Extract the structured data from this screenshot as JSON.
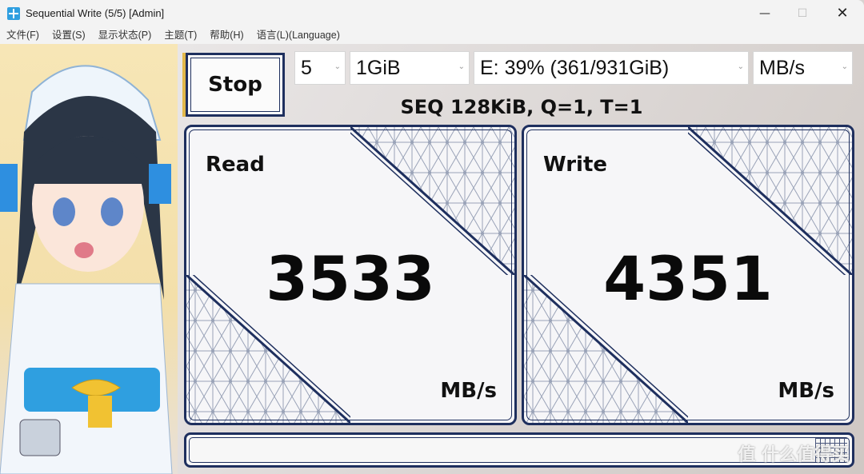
{
  "window": {
    "title": "Sequential Write (5/5) [Admin]",
    "minimize": "—",
    "maximize": "☐",
    "close": "✕"
  },
  "menu": [
    "文件(F)",
    "设置(S)",
    "显示状态(P)",
    "主题(T)",
    "帮助(H)",
    "语言(L)(Language)"
  ],
  "toolbar": {
    "stop_label": "Stop",
    "count": "5",
    "size": "1GiB",
    "drive": "E: 39% (361/931GiB)",
    "unit": "MB/s",
    "chevron": "⌄"
  },
  "test": {
    "label": "SEQ 128KiB, Q=1, T=1"
  },
  "read": {
    "label": "Read",
    "value": "3533",
    "unit": "MB/s"
  },
  "write": {
    "label": "Write",
    "value": "4351",
    "unit": "MB/s"
  },
  "status": {
    "text": ""
  },
  "watermark": "值 什么值得买",
  "colors": {
    "frame": "#1e2f5e",
    "pattern": "#9aa3b8",
    "accent": "#e2b84a"
  }
}
